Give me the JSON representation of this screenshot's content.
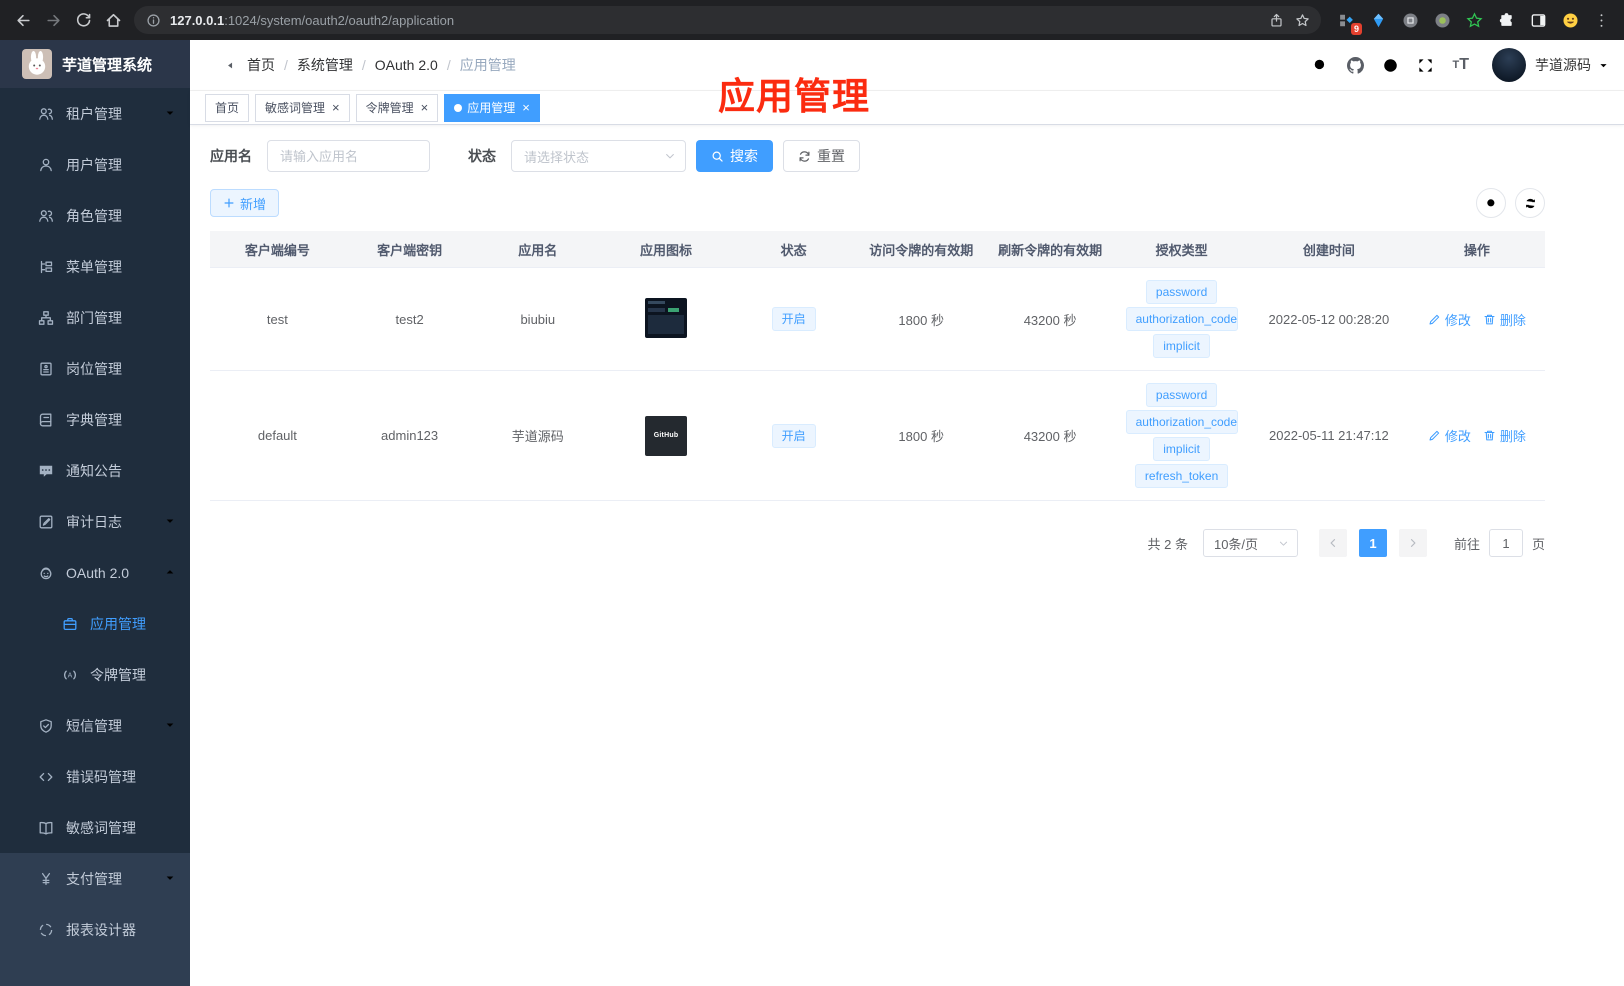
{
  "browser": {
    "url_host": "127.0.0.1",
    "url_rest": ":1024/system/oauth2/oauth2/application",
    "extension_badge": "9",
    "left_icons": [
      "back-icon",
      "forward-icon",
      "reload-icon",
      "home-icon"
    ],
    "urlbar_icons": [
      "info-icon",
      "share-icon",
      "star-icon"
    ],
    "extension_icons": [
      "extensions-grid-icon",
      "gem-icon",
      "command-circle-icon",
      "record-circle-icon",
      "green-star-icon",
      "puzzle-icon",
      "side-panel-icon",
      "emoji-avatar-icon"
    ],
    "menu_icon": "menu-dots-icon"
  },
  "sidebar": {
    "title": "芋道管理系统",
    "logo_icon": "rabbit-logo-icon",
    "items": [
      {
        "id": "tenant",
        "label": "租户管理",
        "icon": "users-icon",
        "chevron": "down",
        "section": "dark"
      },
      {
        "id": "user",
        "label": "用户管理",
        "icon": "user-icon",
        "section": "dark"
      },
      {
        "id": "role",
        "label": "角色管理",
        "icon": "users-icon",
        "section": "dark"
      },
      {
        "id": "menu",
        "label": "菜单管理",
        "icon": "tree-icon",
        "section": "dark"
      },
      {
        "id": "dept",
        "label": "部门管理",
        "icon": "sitemap-icon",
        "section": "dark"
      },
      {
        "id": "post",
        "label": "岗位管理",
        "icon": "badge-icon",
        "section": "dark"
      },
      {
        "id": "dict",
        "label": "字典管理",
        "icon": "dict-icon",
        "section": "dark"
      },
      {
        "id": "notice",
        "label": "通知公告",
        "icon": "notice-icon",
        "section": "dark"
      },
      {
        "id": "audit-log",
        "label": "审计日志",
        "icon": "log-icon",
        "chevron": "down",
        "section": "dark"
      },
      {
        "id": "oauth2",
        "label": "OAuth 2.0",
        "icon": "robot-icon",
        "chevron": "up",
        "section": "dark"
      },
      {
        "id": "oauth2-application",
        "label": "应用管理",
        "icon": "briefcase-icon",
        "sub": true,
        "active": true,
        "section": "dark"
      },
      {
        "id": "oauth2-token",
        "label": "令牌管理",
        "icon": "signal-icon",
        "sub": true,
        "section": "dark"
      },
      {
        "id": "sms",
        "label": "短信管理",
        "icon": "shield-icon",
        "chevron": "down",
        "section": "dark"
      },
      {
        "id": "error-code",
        "label": "错误码管理",
        "icon": "code-icon",
        "section": "dark"
      },
      {
        "id": "sensitive-word",
        "label": "敏感词管理",
        "icon": "openbook-icon",
        "section": "dark"
      },
      {
        "id": "pay",
        "label": "支付管理",
        "icon": "yen-icon",
        "chevron": "down",
        "section": "light"
      },
      {
        "id": "report",
        "label": "报表设计器",
        "icon": "report-icon",
        "section": "light"
      }
    ]
  },
  "header": {
    "breadcrumbs": [
      "首页",
      "系统管理",
      "OAuth 2.0",
      "应用管理"
    ],
    "icons": [
      "search-icon",
      "github-icon",
      "question-icon",
      "fullscreen-icon",
      "font-size-icon"
    ],
    "username": "芋道源码"
  },
  "tabs": [
    {
      "id": "home",
      "label": "首页",
      "closable": false,
      "active": false
    },
    {
      "id": "sensitive-word",
      "label": "敏感词管理",
      "closable": true,
      "active": false
    },
    {
      "id": "token",
      "label": "令牌管理",
      "closable": true,
      "active": false
    },
    {
      "id": "application",
      "label": "应用管理",
      "closable": true,
      "active": true
    }
  ],
  "annotation": {
    "text": "应用管理",
    "color": "#fb2b10"
  },
  "filters": {
    "app_name_label": "应用名",
    "app_name_placeholder": "请输入应用名",
    "status_label": "状态",
    "status_placeholder": "请选择状态",
    "search_label": "搜索",
    "reset_label": "重置"
  },
  "toolbar": {
    "add_label": "新增"
  },
  "table": {
    "columns": [
      "客户端编号",
      "客户端密钥",
      "应用名",
      "应用图标",
      "状态",
      "访问令牌的有效期",
      "刷新令牌的有效期",
      "授权类型",
      "创建时间",
      "操作"
    ],
    "edit_label": "修改",
    "delete_label": "删除",
    "rows": [
      {
        "client_id": "test",
        "secret": "test2",
        "name": "biubiu",
        "icon": "dashboard",
        "icon_label": "",
        "status": "开启",
        "access": "1800 秒",
        "refresh": "43200 秒",
        "grants": [
          "password",
          "authorization_code",
          "implicit"
        ],
        "created": "2022-05-12 00:28:20"
      },
      {
        "client_id": "default",
        "secret": "admin123",
        "name": "芋道源码",
        "icon": "github",
        "icon_label": "GitHub",
        "status": "开启",
        "access": "1800 秒",
        "refresh": "43200 秒",
        "grants": [
          "password",
          "authorization_code",
          "implicit",
          "refresh_token"
        ],
        "created": "2022-05-11 21:47:12"
      }
    ]
  },
  "pagination": {
    "total_text": "共 2 条",
    "page_size": "10条/页",
    "current_page": "1",
    "goto_label": "前往",
    "goto_value": "1",
    "page_label": "页"
  },
  "colors": {
    "accent": "#409eff",
    "sidebar_dark": "#1f2d3d",
    "sidebar_light": "#2f3e52",
    "tag_bg": "#ecf5ff",
    "annotation_red": "#fb2b10"
  }
}
